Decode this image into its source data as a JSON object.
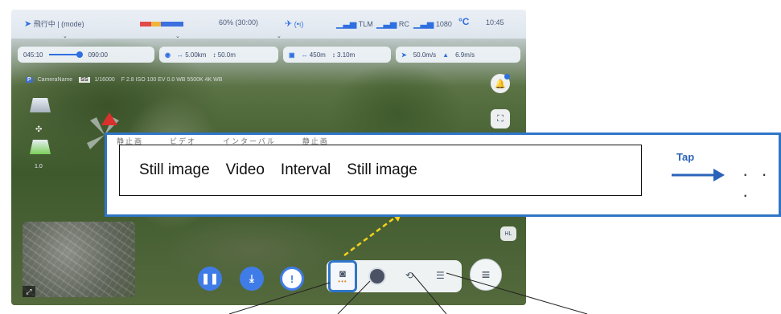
{
  "status_bar": {
    "flight_mode": "飛行中 | (mode)",
    "battery_text": "60% (30:00)",
    "rc_signal": "(•ı)",
    "tlm_label": "TLM",
    "rc_label": "RC",
    "video_label": "1080",
    "temp_unit": "°C",
    "time": "10:45"
  },
  "telemetry": {
    "elapsed": "045:10",
    "total": "090:00",
    "home_distance": "5.00km",
    "home_altitude": "50.0m",
    "drone_distance": "450m",
    "drone_altitude": "3.10m",
    "horizontal_speed": "50.0m/s",
    "vertical_speed": "6.9m/s"
  },
  "camera_row": {
    "mode_badge": "P",
    "camera_name": "CameraName",
    "shutter_badge": "SS",
    "shutter": "1/16000",
    "rest": "F 2.8   ISO 100   EV 0.0   WB 5500K   4K   WB"
  },
  "left_indicator": {
    "top_value": "",
    "bottom_value": "1.0"
  },
  "side_buttons": {
    "hr_label": "HL"
  },
  "toolbar": {
    "camera_icon": "camera-icon",
    "record_icon": "record-icon",
    "interval_icon": "interval-icon",
    "settings_icon": "sliders-icon",
    "menu_icon": "menu-icon"
  },
  "callout": {
    "items": [
      "Still image",
      "Video",
      "Interval",
      "Still image"
    ],
    "tap_label": "Tap",
    "ellipsis": "· · ·"
  },
  "colors": {
    "accent": "#2f6fe0",
    "callout_border": "#2f75c8",
    "pause_button": "#3f7ce8",
    "download_button": "#3f7ce8",
    "warning_ring": "#3f7ce8",
    "battery_red": "#e14a4a",
    "battery_yellow": "#f1b43b",
    "battery_blue": "#3c6fe0"
  }
}
